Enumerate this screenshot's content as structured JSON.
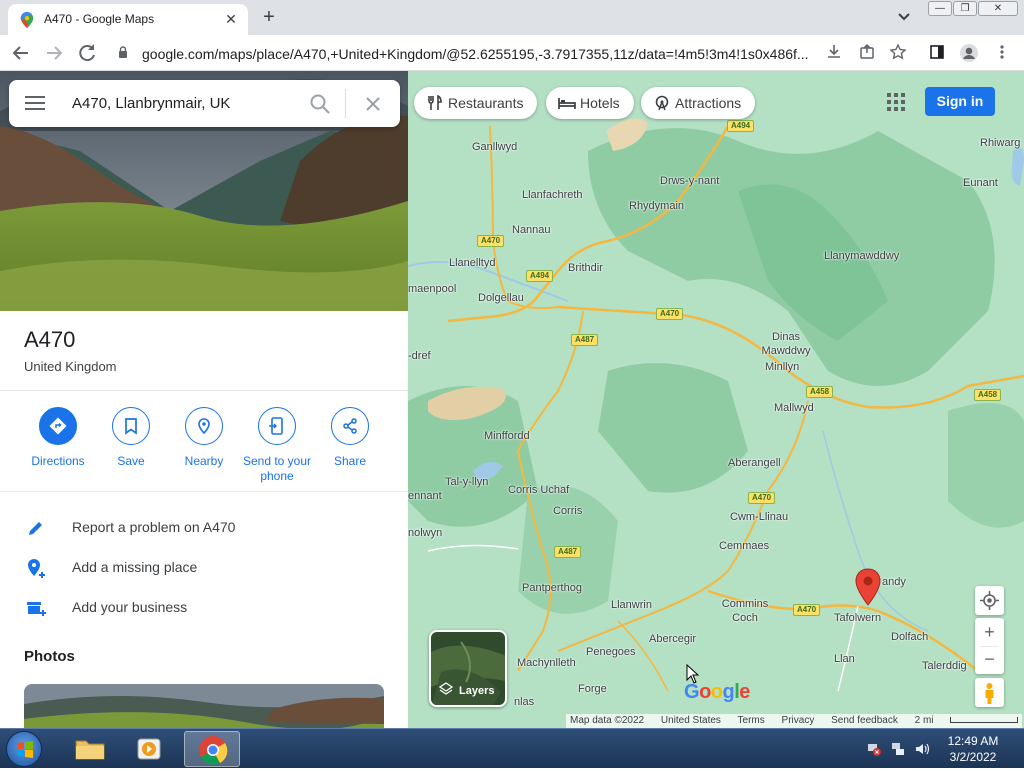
{
  "browser": {
    "tab_title": "A470 - Google Maps",
    "tab_close": "✕",
    "new_tab": "+",
    "url": "google.com/maps/place/A470,+United+Kingdom/@52.6255195,-3.7917355,11z/data=!4m5!3m4!1s0x486f..."
  },
  "search": {
    "query": "A470, Llanbrynmair, UK"
  },
  "place": {
    "title": "A470",
    "subtitle": "United Kingdom",
    "actions": [
      {
        "label": "Directions",
        "icon": "directions-icon"
      },
      {
        "label": "Save",
        "icon": "bookmark-icon"
      },
      {
        "label": "Nearby",
        "icon": "nearby-icon"
      },
      {
        "label": "Send to your phone",
        "icon": "phone-icon"
      },
      {
        "label": "Share",
        "icon": "share-icon"
      }
    ],
    "rows": [
      {
        "label": "Report a problem on A470",
        "icon": "pencil-icon"
      },
      {
        "label": "Add a missing place",
        "icon": "add-place-icon"
      },
      {
        "label": "Add your business",
        "icon": "add-business-icon"
      }
    ],
    "photos_heading": "Photos"
  },
  "map": {
    "chips": [
      "Restaurants",
      "Hotels",
      "Attractions"
    ],
    "signin": "Sign in",
    "layers": "Layers",
    "zoom_in": "+",
    "zoom_out": "−",
    "watermark": "Google",
    "footer": [
      "Map data ©2022",
      "United States",
      "Terms",
      "Privacy",
      "Send feedback",
      "2 mi"
    ],
    "towns": [
      "Ganllwyd",
      "Llanfachreth",
      "Drws-y-nant",
      "Rhydymain",
      "Nannau",
      "Llanelltyd",
      "Brithdir",
      "maenpool",
      "Dolgellau",
      "Rhiwarg",
      "Eunant",
      "Llanymawddwy",
      "Dinas Mawddwy",
      "Minllyn",
      "Mallwyd",
      "-dref",
      "Minffordd",
      "Aberangell",
      "Tal-y-llyn",
      "Corris Uchaf",
      "Corris",
      "ennant",
      "nolwyn",
      "Cwm-Llinau",
      "Cemmaes",
      "Pantperthog",
      "Llanwrin",
      "Commins Coch",
      "andy",
      "Tafolwern",
      "Dolfach",
      "Abercegir",
      "Penegoes",
      "Machynlleth",
      "Llan",
      "Talerddig",
      "Forge",
      "nlas"
    ],
    "roads": [
      "A494",
      "A470",
      "A494",
      "A470",
      "A487",
      "A458",
      "A458",
      "A470",
      "A487",
      "A470"
    ]
  },
  "taskbar": {
    "time": "12:49 AM",
    "date": "3/2/2022"
  },
  "colors": {
    "accent": "#1a73e8",
    "map_green": "#b4e0c4",
    "pin": "#ea4335"
  }
}
